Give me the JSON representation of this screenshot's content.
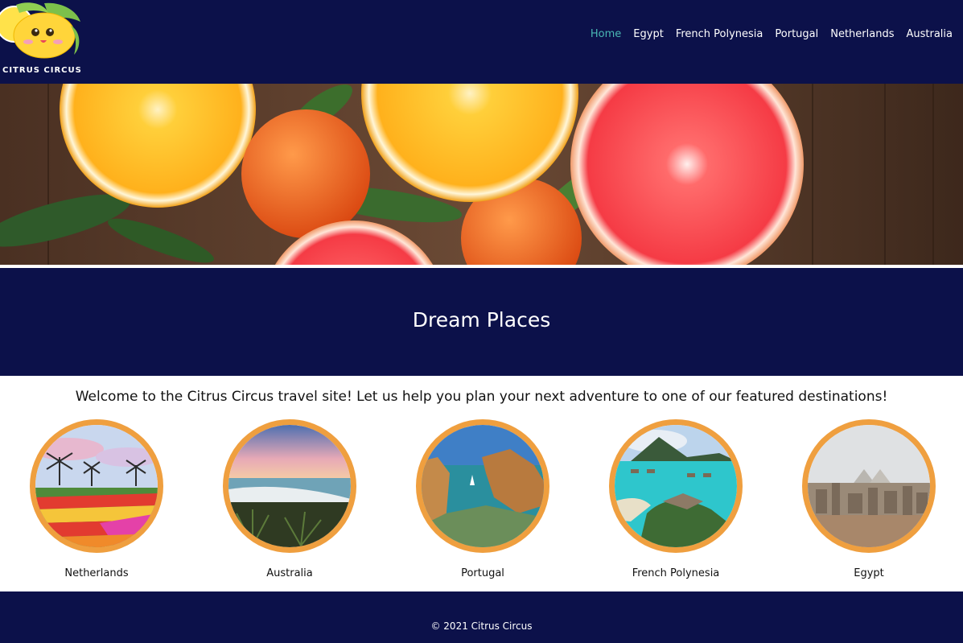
{
  "header": {
    "logo_text": "CITRUS CIRCUS",
    "nav": [
      {
        "label": "Home",
        "active": true
      },
      {
        "label": "Egypt"
      },
      {
        "label": "French Polynesia"
      },
      {
        "label": "Portugal"
      },
      {
        "label": "Netherlands"
      },
      {
        "label": "Australia"
      }
    ]
  },
  "banner": {
    "title": "Dream Places"
  },
  "main": {
    "intro": "Welcome to the Citrus Circus travel site! Let us help you plan your next adventure to one of our featured destinations!",
    "destinations": [
      {
        "label": "Netherlands"
      },
      {
        "label": "Australia"
      },
      {
        "label": "Portugal"
      },
      {
        "label": "French Polynesia"
      },
      {
        "label": "Egypt"
      }
    ]
  },
  "footer": {
    "copyright": "© 2021 Citrus Circus"
  },
  "colors": {
    "navy": "#0c114a",
    "active_link": "#4ab8b4",
    "ring": "#ef9f3f"
  }
}
